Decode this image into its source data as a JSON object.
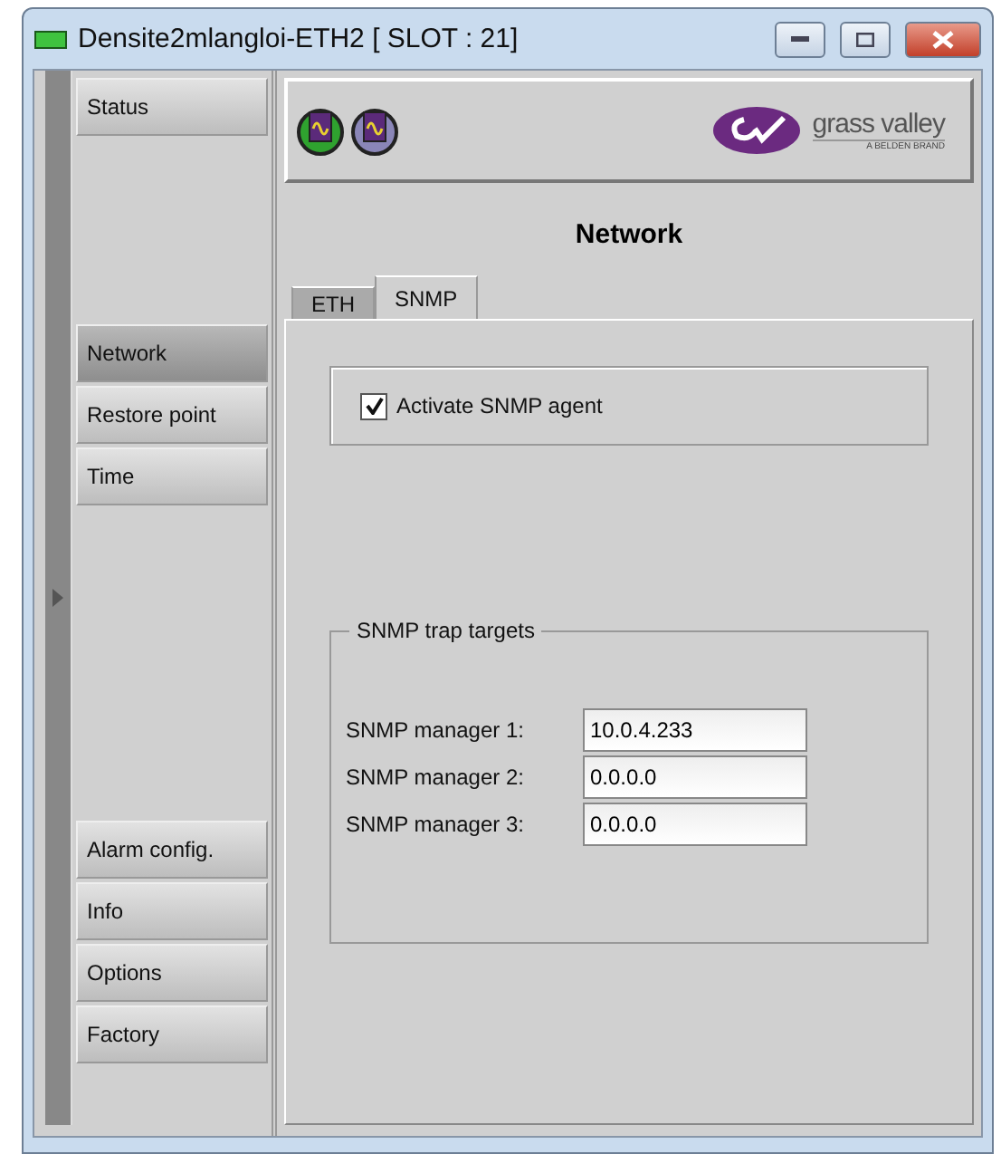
{
  "window": {
    "title": "Densite2mlangloi-ETH2 [ SLOT : 21]"
  },
  "sidebar": {
    "groups": [
      [
        {
          "label": "Status",
          "selected": false
        }
      ],
      [
        {
          "label": "Network",
          "selected": true
        },
        {
          "label": "Restore point",
          "selected": false
        },
        {
          "label": "Time",
          "selected": false
        }
      ],
      [
        {
          "label": "Alarm config.",
          "selected": false
        },
        {
          "label": "Info",
          "selected": false
        },
        {
          "label": "Options",
          "selected": false
        },
        {
          "label": "Factory",
          "selected": false
        }
      ]
    ]
  },
  "header": {
    "status_icons": [
      {
        "color": "#2fa22f"
      },
      {
        "color": "#8a86b8"
      }
    ],
    "logo": {
      "name": "grass valley",
      "tagline": "A BELDEN BRAND"
    }
  },
  "page_title": "Network",
  "tabs": [
    {
      "label": "ETH",
      "selected": false
    },
    {
      "label": "SNMP",
      "selected": true
    }
  ],
  "agent": {
    "label": "Activate SNMP agent",
    "checked": true
  },
  "trap_targets": {
    "title": "SNMP trap targets",
    "fields": [
      {
        "label": "SNMP manager 1:",
        "value": "10.0.4.233"
      },
      {
        "label": "SNMP manager 2:",
        "value": "0.0.0.0"
      },
      {
        "label": "SNMP manager 3:",
        "value": "0.0.0.0"
      }
    ]
  }
}
